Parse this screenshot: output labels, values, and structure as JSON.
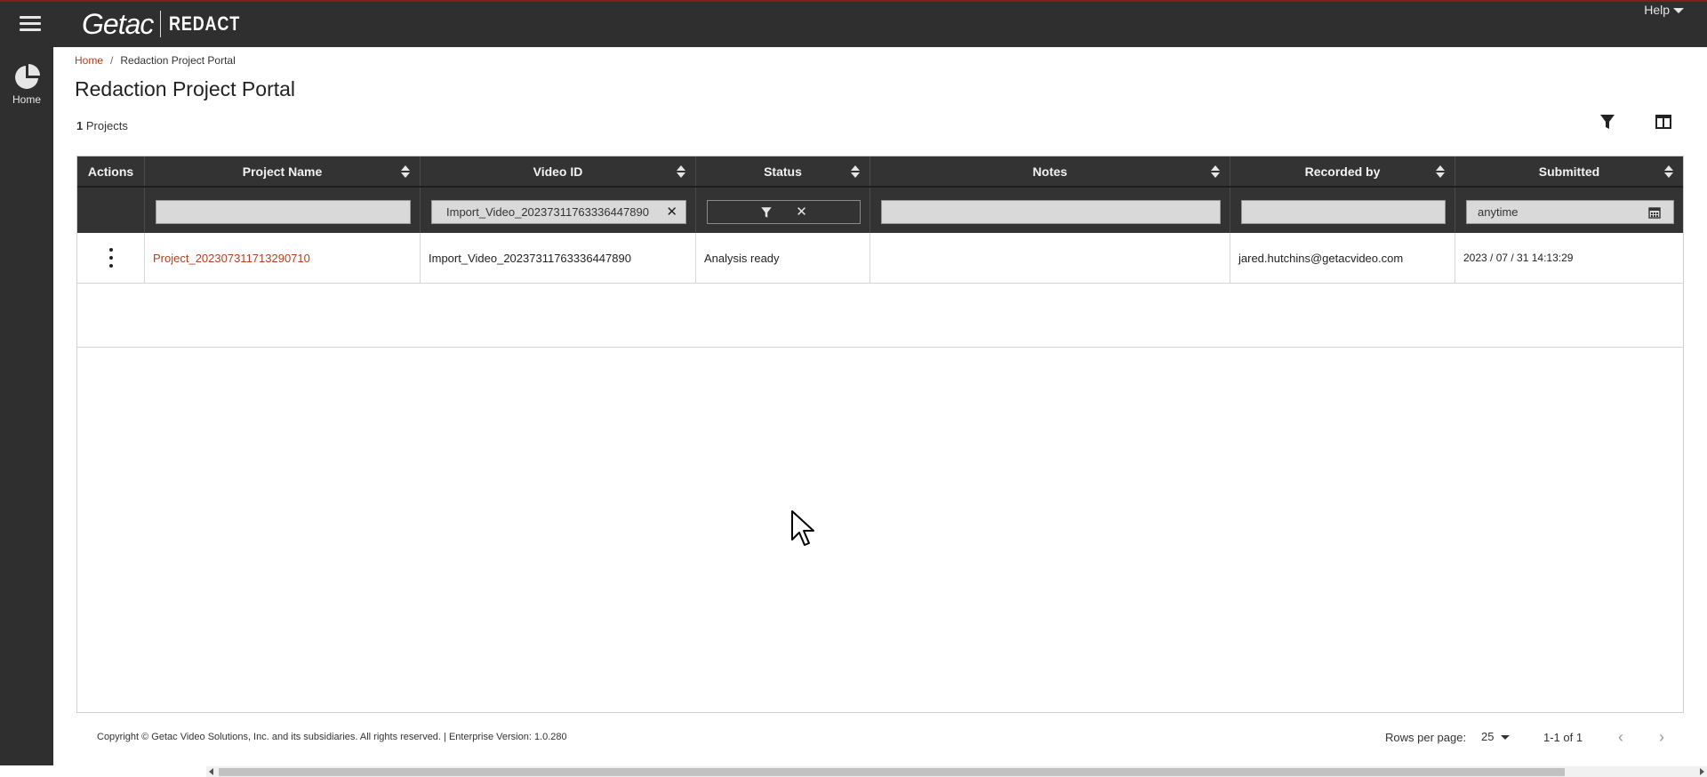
{
  "app": {
    "logo_primary": "Getac",
    "logo_secondary": "REDACT",
    "help_label": "Help"
  },
  "sidebar": {
    "items": [
      {
        "label": "Home",
        "icon": "pie-chart-icon"
      }
    ]
  },
  "breadcrumb": {
    "home": "Home",
    "current": "Redaction Project Portal"
  },
  "page": {
    "title": "Redaction Project Portal",
    "project_count": "1",
    "project_count_suffix": "Projects"
  },
  "toolbar": {
    "filter_icon": "filter-icon",
    "columns_icon": "columns-icon"
  },
  "table": {
    "columns": [
      "Actions",
      "Project Name",
      "Video ID",
      "Status",
      "Notes",
      "Recorded by",
      "Submitted"
    ],
    "filters": {
      "project_name": "",
      "video_id": "Import_Video_20237311763336447890",
      "notes": "",
      "recorded_by": "",
      "submitted": "anytime"
    },
    "rows": [
      {
        "project_name": "Project_202307311713290710",
        "video_id": "Import_Video_20237311763336447890",
        "status": "Analysis ready",
        "notes": "",
        "recorded_by": "jared.hutchins@getacvideo.com",
        "submitted": "2023 / 07 / 31 14:13:29"
      }
    ]
  },
  "footer": {
    "copyright": "Copyright © Getac Video Solutions, Inc. and its subsidiaries. All rights reserved. | Enterprise Version: 1.0.280",
    "rows_per_page_label": "Rows per page:",
    "rows_per_page_value": "25",
    "range": "1-1 of 1"
  },
  "colors": {
    "topbar": "#2f2f2f",
    "accent_link": "#b3401f",
    "header_bg": "#333333"
  }
}
